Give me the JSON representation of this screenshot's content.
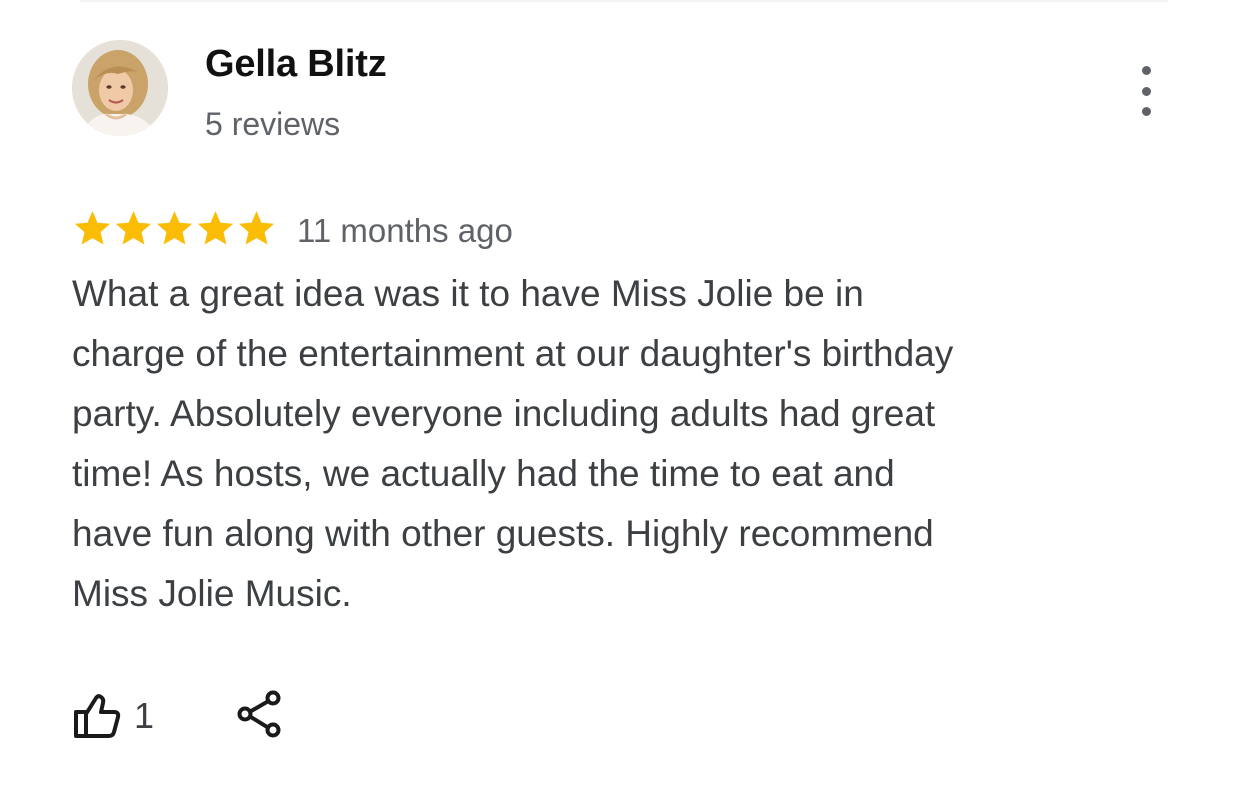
{
  "review": {
    "author": {
      "name": "Gella Blitz",
      "review_count": "5 reviews"
    },
    "rating": 5,
    "max_rating": 5,
    "date": "11 months ago",
    "text": "What a great idea was it to have Miss Jolie be in\ncharge of the entertainment at our daughter's birthday\nparty. Absolutely everyone including adults had great\ntime! As hosts, we actually had the time to eat and\nhave fun along with other guests. Highly recommend\nMiss Jolie Music.",
    "helpful_count": "1"
  },
  "icons": {
    "star": "star-icon",
    "more": "more-vertical-icon",
    "like": "thumbs-up-icon",
    "share": "share-icon"
  },
  "colors": {
    "star": "#fbbc04",
    "name": "#111111",
    "secondary_text": "#5f6368",
    "body_text": "#3c4043"
  }
}
